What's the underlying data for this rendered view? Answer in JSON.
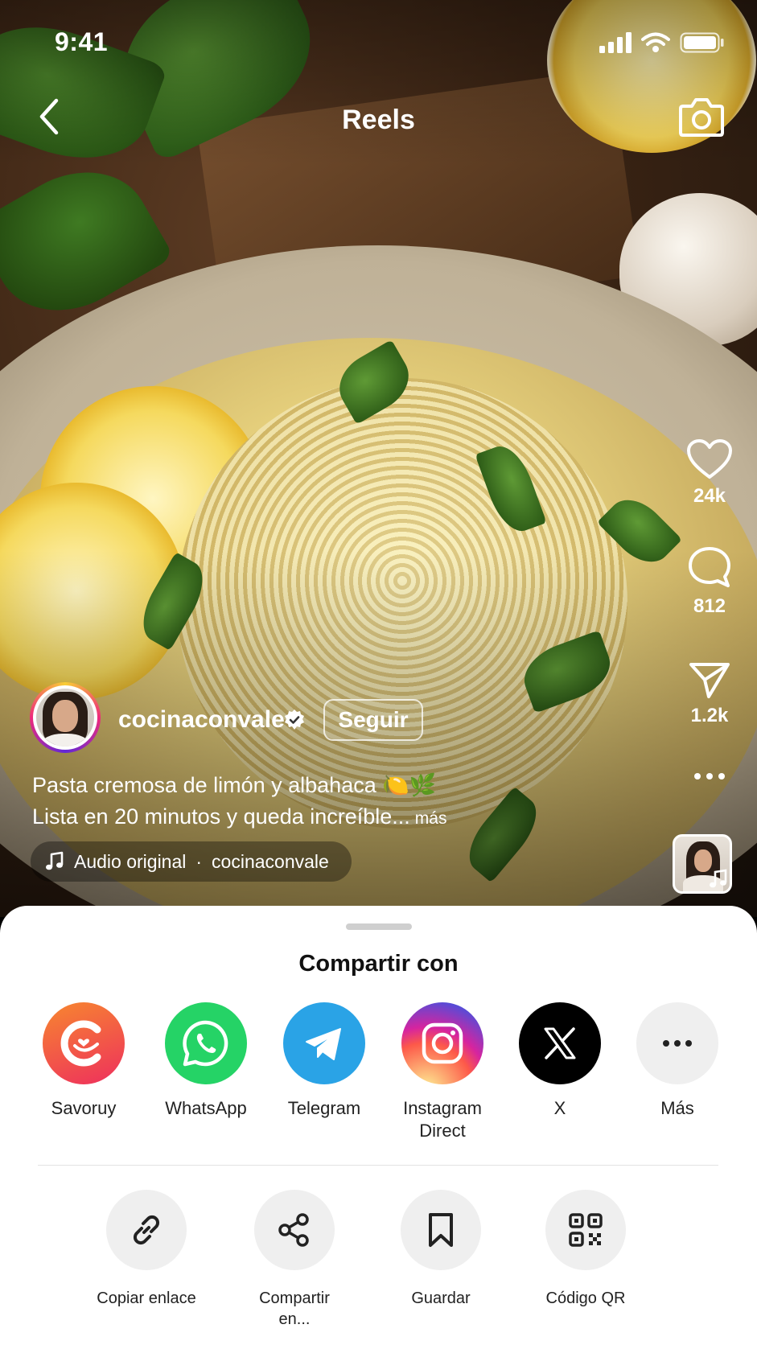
{
  "status": {
    "time": "9:41"
  },
  "nav": {
    "title": "Reels"
  },
  "rail": {
    "likes": "24k",
    "comments": "812",
    "shares": "1.2k"
  },
  "post": {
    "username": "cocinaconvale",
    "follow_label": "Seguir",
    "caption_line1": "Pasta cremosa de limón y albahaca 🍋🌿",
    "caption_line2": "Lista en 20 minutos y queda increíble...",
    "more_label": "más",
    "audio_label": "Audio original",
    "audio_separator": "·",
    "audio_author": "cocinaconvale"
  },
  "share": {
    "title": "Compartir con",
    "apps": [
      {
        "label": "Savoruy",
        "icon": "savoruy-icon",
        "color": "#f0542f"
      },
      {
        "label": "WhatsApp",
        "icon": "whatsapp-icon",
        "color": "#25d366"
      },
      {
        "label": "Telegram",
        "icon": "telegram-icon",
        "color": "#2aa3e6"
      },
      {
        "label": "Instagram Direct",
        "icon": "instagram-icon",
        "color": "#d62976"
      },
      {
        "label": "X",
        "icon": "x-icon",
        "color": "#000000"
      },
      {
        "label": "Más",
        "icon": "more-icon",
        "color": "#efefef"
      }
    ],
    "actions": [
      {
        "label": "Copiar enlace",
        "icon": "link-icon"
      },
      {
        "label": "Compartir en...",
        "icon": "share-icon"
      },
      {
        "label": "Guardar",
        "icon": "bookmark-icon"
      },
      {
        "label": "Código QR",
        "icon": "qr-code-icon"
      }
    ]
  }
}
